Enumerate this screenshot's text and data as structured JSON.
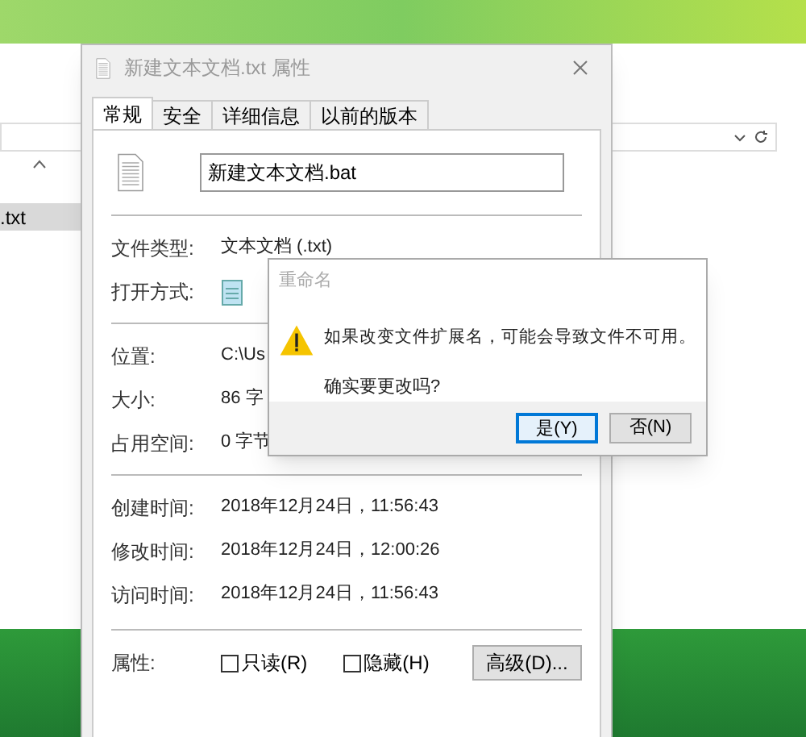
{
  "explorer": {
    "selected_file": ".txt"
  },
  "properties": {
    "title": "新建文本文档.txt 属性",
    "tabs": [
      {
        "label": "常规",
        "selected": true
      },
      {
        "label": "安全",
        "selected": false
      },
      {
        "label": "详细信息",
        "selected": false
      },
      {
        "label": "以前的版本",
        "selected": false
      }
    ],
    "name_field": {
      "value": "新建文本文档.bat"
    },
    "groups": [
      [
        {
          "label": "文件类型:",
          "value": "文本文档 (.txt)"
        },
        {
          "label": "打开方式:",
          "kind": "app"
        }
      ],
      [
        {
          "label": "位置:",
          "value": "C:\\Us"
        },
        {
          "label": "大小:",
          "value": "86 字"
        },
        {
          "label": "占用空间:",
          "value": "0 字节"
        }
      ],
      [
        {
          "label": "创建时间:",
          "value": "2018年12月24日，11:56:43"
        },
        {
          "label": "修改时间:",
          "value": "2018年12月24日，12:00:26"
        },
        {
          "label": "访问时间:",
          "value": "2018年12月24日，11:56:43"
        }
      ]
    ],
    "attributes": {
      "label": "属性:",
      "checkboxes": [
        {
          "label": "只读(R)",
          "checked": false
        },
        {
          "label": "隐藏(H)",
          "checked": false
        }
      ],
      "advanced_button": "高级(D)..."
    }
  },
  "rename_dialog": {
    "title": "重命名",
    "message": "如果改变文件扩展名，可能会导致文件不可用。",
    "question": "确实要更改吗?",
    "buttons": [
      {
        "label": "是(Y)",
        "selected": true
      },
      {
        "label": "否(N)",
        "selected": false
      }
    ]
  }
}
